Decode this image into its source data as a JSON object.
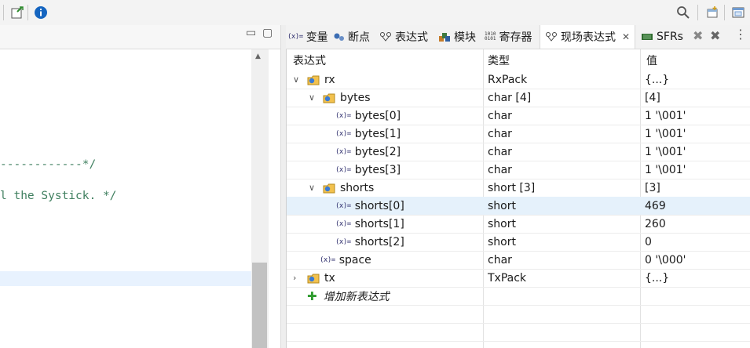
{
  "toolbar": {
    "icons": [
      "pin-icon",
      "info-icon",
      "search-icon",
      "perspective-icon",
      "window-icon"
    ]
  },
  "editor": {
    "code_lines": [
      "------------*/",
      "l the Systick. */"
    ]
  },
  "tabs": [
    {
      "icon": "variables-icon",
      "label": "变量"
    },
    {
      "icon": "breakpoints-icon",
      "label": "断点"
    },
    {
      "icon": "expressions-icon",
      "label": "表达式"
    },
    {
      "icon": "modules-icon",
      "label": "模块"
    },
    {
      "icon": "registers-icon",
      "label": "寄存器"
    },
    {
      "icon": "live-expressions-icon",
      "label": "现场表达式",
      "close": "✕"
    },
    {
      "icon": "sfrs-icon",
      "label": "SFRs"
    }
  ],
  "tree": {
    "columns": [
      "表达式",
      "类型",
      "值"
    ],
    "rows": [
      {
        "name": "rx",
        "type": "RxPack",
        "value": "{...}",
        "level": 0,
        "toggle": "expanded",
        "icon": "struct"
      },
      {
        "name": "bytes",
        "type": "char [4]",
        "value": "[4]",
        "level": 1,
        "toggle": "expanded",
        "icon": "struct"
      },
      {
        "name": "bytes[0]",
        "type": "char",
        "value": "1 '\\001'",
        "level": 2,
        "icon": "var"
      },
      {
        "name": "bytes[1]",
        "type": "char",
        "value": "1 '\\001'",
        "level": 2,
        "icon": "var"
      },
      {
        "name": "bytes[2]",
        "type": "char",
        "value": "1 '\\001'",
        "level": 2,
        "icon": "var"
      },
      {
        "name": "bytes[3]",
        "type": "char",
        "value": "1 '\\001'",
        "level": 2,
        "icon": "var"
      },
      {
        "name": "shorts",
        "type": "short [3]",
        "value": "[3]",
        "level": 1,
        "toggle": "expanded",
        "icon": "struct"
      },
      {
        "name": "shorts[0]",
        "type": "short",
        "value": "469",
        "level": 2,
        "icon": "var",
        "selected": true
      },
      {
        "name": "shorts[1]",
        "type": "short",
        "value": "260",
        "level": 2,
        "icon": "var"
      },
      {
        "name": "shorts[2]",
        "type": "short",
        "value": "0",
        "level": 2,
        "icon": "var"
      },
      {
        "name": "space",
        "type": "char",
        "value": "0 '\\000'",
        "level": 1,
        "icon": "var"
      },
      {
        "name": "tx",
        "type": "TxPack",
        "value": "{...}",
        "level": 0,
        "toggle": "collapsed",
        "icon": "struct"
      }
    ],
    "add_label": "增加新表达式"
  },
  "colors": {
    "comment": "#3f7f5f",
    "selection": "#e5f1fb",
    "accent": "#1a6fd1"
  }
}
